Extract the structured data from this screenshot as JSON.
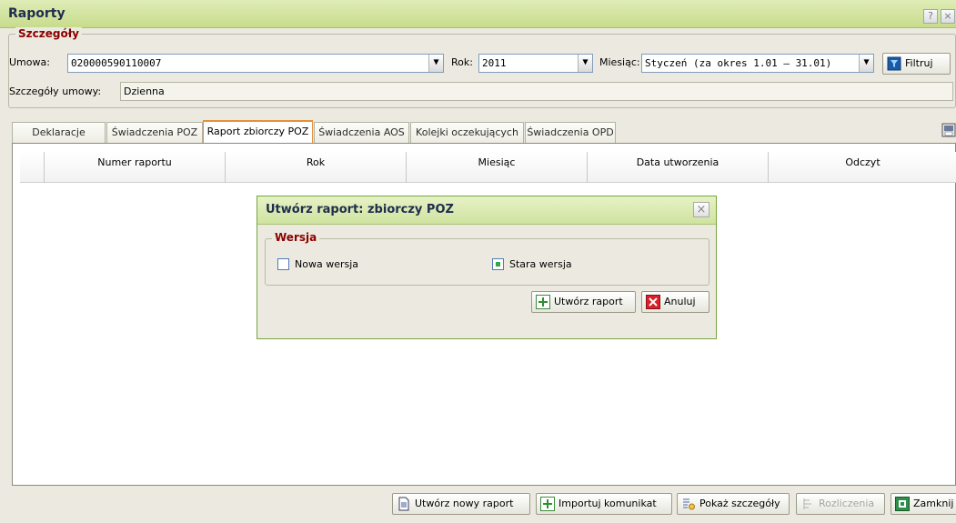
{
  "window": {
    "title": "Raporty",
    "help_label": "?",
    "close_label": "×"
  },
  "details": {
    "legend": "Szczegóły",
    "contract_label": "Umowa:",
    "contract_value": "020000590110007",
    "year_label": "Rok:",
    "year_value": "2011",
    "month_label": "Miesiąc:",
    "month_value": "Styczeń (za okres 1.01 – 31.01)",
    "filter_label": "Filtruj",
    "contract_details_label": "Szczegóły umowy:",
    "contract_details_value": "Dzienna"
  },
  "tabs": [
    {
      "label": "Deklaracje",
      "active": false
    },
    {
      "label": "Świadczenia POZ",
      "active": false
    },
    {
      "label": "Raport zbiorczy POZ",
      "active": true
    },
    {
      "label": "Świadczenia AOS",
      "active": false
    },
    {
      "label": "Kolejki oczekujących",
      "active": false
    },
    {
      "label": "Świadczenia OPD",
      "active": false
    }
  ],
  "grid": {
    "columns": [
      "Numer raportu",
      "Rok",
      "Miesiąc",
      "Data utworzenia",
      "Odczyt"
    ]
  },
  "modal": {
    "title": "Utwórz raport: zbiorczy POZ",
    "close_label": "×",
    "legend": "Wersja",
    "option_new": "Nowa wersja",
    "option_old": "Stara wersja",
    "new_checked": false,
    "old_checked": true,
    "create_label": "Utwórz raport",
    "cancel_label": "Anuluj"
  },
  "footer": {
    "new_report_label": "Utwórz nowy raport",
    "import_label": "Importuj komunikat",
    "details_label": "Pokaż szczegóły",
    "settlements_label": "Rozliczenia",
    "close_label": "Zamknij"
  },
  "colors": {
    "accent_orange": "#e3913a",
    "title_green": "#c8dc8c",
    "legend_red": "#8b0000"
  }
}
